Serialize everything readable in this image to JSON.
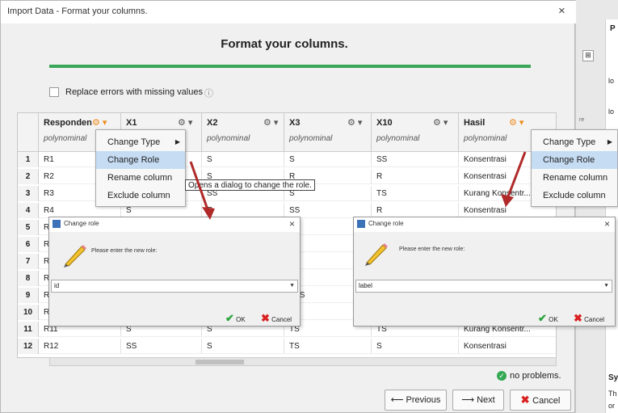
{
  "dialog": {
    "title": "Import Data - Format your columns.",
    "close": "×",
    "header": "Format your columns.",
    "replace_errors_label": "Replace errors with missing values",
    "info_glyph": "ⓘ"
  },
  "columns": [
    {
      "name": "Responden",
      "type": "polynominal",
      "gear_color": "#f08a1a"
    },
    {
      "name": "X1",
      "type": "",
      "gear_color": "#555555"
    },
    {
      "name": "X2",
      "type": "polynominal",
      "gear_color": "#555555"
    },
    {
      "name": "X3",
      "type": "polynominal",
      "gear_color": "#555555"
    },
    {
      "name": "X10",
      "type": "polynominal",
      "gear_color": "#555555"
    },
    {
      "name": "Hasil",
      "type": "polynominal",
      "gear_color": "#f08a1a"
    }
  ],
  "rows": [
    {
      "num": "1",
      "cells": [
        "R1",
        "",
        "S",
        "S",
        "SS",
        "Konsentrasi"
      ]
    },
    {
      "num": "2",
      "cells": [
        "R2",
        "",
        "S",
        "R",
        "R",
        "Konsentrasi"
      ]
    },
    {
      "num": "3",
      "cells": [
        "R3",
        "",
        "SS",
        "S",
        "TS",
        "Kurang Konsentr..."
      ]
    },
    {
      "num": "4",
      "cells": [
        "R4",
        "S",
        "R",
        "SS",
        "R",
        "Konsentrasi"
      ]
    },
    {
      "num": "5",
      "cells": [
        "R",
        "",
        "",
        "R",
        "",
        ""
      ]
    },
    {
      "num": "6",
      "cells": [
        "R",
        "",
        "",
        "R",
        "",
        ""
      ]
    },
    {
      "num": "7",
      "cells": [
        "R",
        "",
        "",
        "SS",
        "",
        ""
      ]
    },
    {
      "num": "8",
      "cells": [
        "R",
        "",
        "",
        "S",
        "",
        ""
      ]
    },
    {
      "num": "9",
      "cells": [
        "R",
        "",
        "",
        "STS",
        "",
        ""
      ]
    },
    {
      "num": "10",
      "cells": [
        "R",
        "",
        "",
        "SS",
        "",
        ""
      ]
    },
    {
      "num": "11",
      "cells": [
        "R11",
        "S",
        "S",
        "TS",
        "TS",
        "Kurang Konsentr..."
      ]
    },
    {
      "num": "12",
      "cells": [
        "R12",
        "SS",
        "S",
        "TS",
        "S",
        "Konsentrasi"
      ]
    }
  ],
  "context_menu": {
    "items": [
      "Change Type",
      "Change Role",
      "Rename column",
      "Exclude column"
    ]
  },
  "tooltip": "Opens a dialog to change the role.",
  "change_role_left": {
    "title": "Change role",
    "prompt": "Please enter the new role:",
    "value": "id",
    "ok": "OK",
    "cancel": "Cancel"
  },
  "change_role_right": {
    "title": "Change role",
    "prompt": "Please enter the new role:",
    "value": "label",
    "ok": "OK",
    "cancel": "Cancel"
  },
  "status": "no problems.",
  "buttons": {
    "previous": "Previous",
    "next": "Next",
    "cancel": "Cancel"
  },
  "background_app": {
    "side_labels": [
      "P",
      "lo",
      "lo",
      "re",
      "Sy",
      "Th",
      "or"
    ]
  },
  "colors": {
    "accent_green": "#3aa657",
    "menu_highlight": "#c6dcf3",
    "arrow": "#b02a2a"
  }
}
